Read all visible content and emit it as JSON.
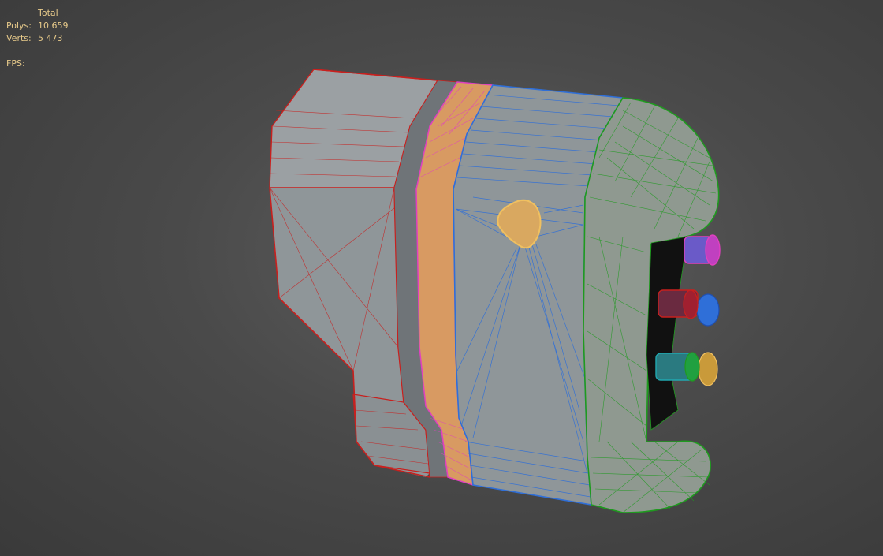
{
  "stats": {
    "header": "Total",
    "polys_label": "Polys:",
    "polys_value": "10 659",
    "verts_label": "Verts:",
    "verts_value": "5 473",
    "fps_label": "FPS:"
  },
  "colors": {
    "background": "#4a4a4a",
    "stats_text": "#e6c98a",
    "shaded_surface": "#8f9699",
    "wire_red": "#c8201e",
    "wire_magenta": "#e040c0",
    "wire_orange": "#e89a50",
    "wire_blue": "#2f6fd8",
    "wire_green": "#1f9a1f",
    "wire_yellow": "#f0c060",
    "wire_cyan": "#20a8b0"
  }
}
